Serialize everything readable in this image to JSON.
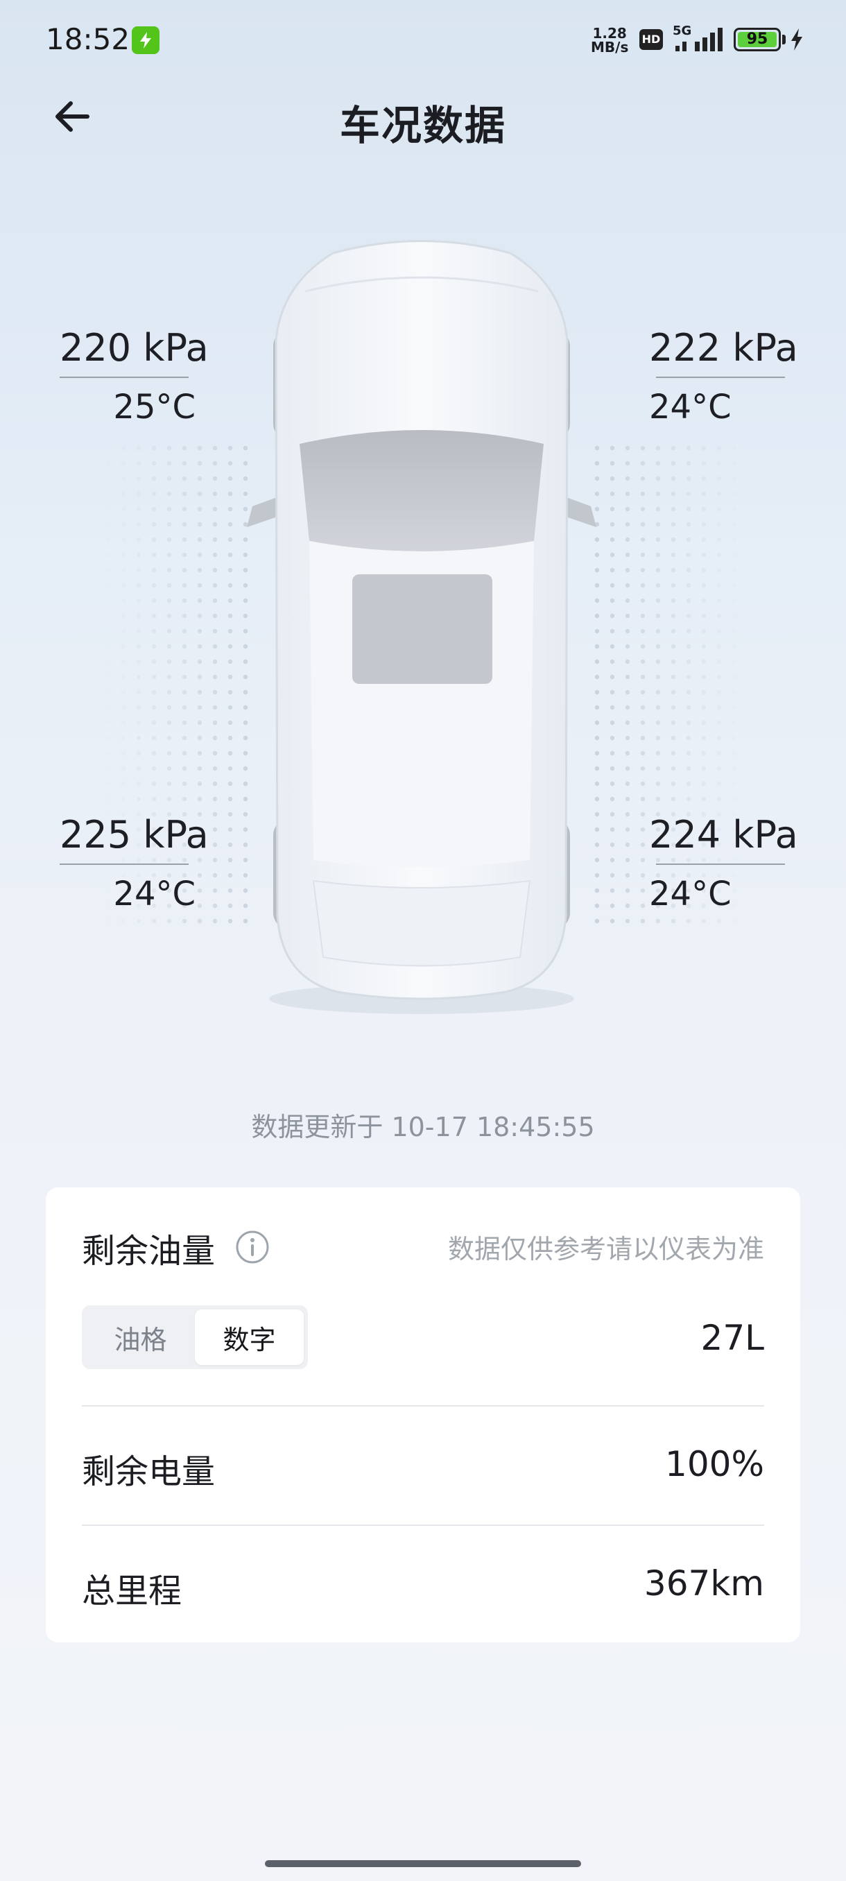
{
  "status_bar": {
    "time": "18:52",
    "net_speed_value": "1.28",
    "net_speed_unit": "MB/s",
    "hd": "HD",
    "network": "5G",
    "battery": "95"
  },
  "header": {
    "title": "车况数据"
  },
  "tires": {
    "front_left": {
      "pressure": "220 kPa",
      "temp": "25°C"
    },
    "front_right": {
      "pressure": "222 kPa",
      "temp": "24°C"
    },
    "rear_left": {
      "pressure": "225 kPa",
      "temp": "24°C"
    },
    "rear_right": {
      "pressure": "224 kPa",
      "temp": "24°C"
    }
  },
  "update_text": "数据更新于 10-17 18:45:55",
  "card": {
    "fuel_title": "剩余油量",
    "hint": "数据仅供参考请以仪表为准",
    "segment": [
      "油格",
      "数字"
    ],
    "segment_active": "数字",
    "fuel_value": "27L",
    "battery_label": "剩余电量",
    "battery_value": "100%",
    "mileage_label": "总里程",
    "mileage_value": "367km"
  },
  "colors": {
    "accent_battery": "#5dce3c",
    "charge_badge": "#52c41a"
  }
}
